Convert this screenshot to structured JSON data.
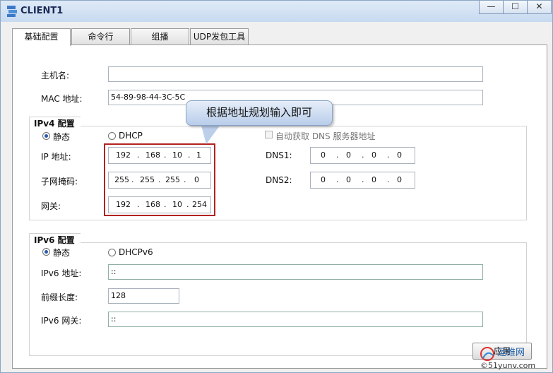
{
  "window": {
    "title": "CLIENT1",
    "controls": {
      "minimize": "—",
      "maximize": "☐",
      "close": "✕"
    }
  },
  "tabs": [
    {
      "label": "基础配置",
      "active": true
    },
    {
      "label": "命令行",
      "active": false
    },
    {
      "label": "组播",
      "active": false
    },
    {
      "label": "UDP发包工具",
      "active": false
    }
  ],
  "basic": {
    "hostname_label": "主机名:",
    "hostname_value": "",
    "mac_label": "MAC 地址:",
    "mac_value": "54-89-98-44-3C-5C"
  },
  "ipv4": {
    "group_title": "IPv4 配置",
    "static_label": "静态",
    "dhcp_label": "DHCP",
    "mode": "static",
    "auto_dns_label": "自动获取 DNS 服务器地址",
    "ip_label": "IP 地址:",
    "ip": [
      "192",
      "168",
      "10",
      "1"
    ],
    "mask_label": "子网掩码:",
    "mask": [
      "255",
      "255",
      "255",
      "0"
    ],
    "gateway_label": "网关:",
    "gateway": [
      "192",
      "168",
      "10",
      "254"
    ],
    "dns1_label": "DNS1:",
    "dns1": [
      "0",
      "0",
      "0",
      "0"
    ],
    "dns2_label": "DNS2:",
    "dns2": [
      "0",
      "0",
      "0",
      "0"
    ]
  },
  "callout": {
    "text": "根据地址规划输入即可"
  },
  "ipv6": {
    "group_title": "IPv6 配置",
    "static_label": "静态",
    "dhcp_label": "DHCPv6",
    "mode": "static",
    "ip_label": "IPv6 地址:",
    "ip_value": "::",
    "prefix_label": "前缀长度:",
    "prefix_value": "128",
    "gateway_label": "IPv6 网关:",
    "gateway_value": "::"
  },
  "actions": {
    "apply_label": "应用"
  },
  "watermark": {
    "line1": "运维网",
    "line2": "©51yunv.com"
  },
  "colors": {
    "highlight_border": "#b22222",
    "title_text": "#1a2a55"
  }
}
